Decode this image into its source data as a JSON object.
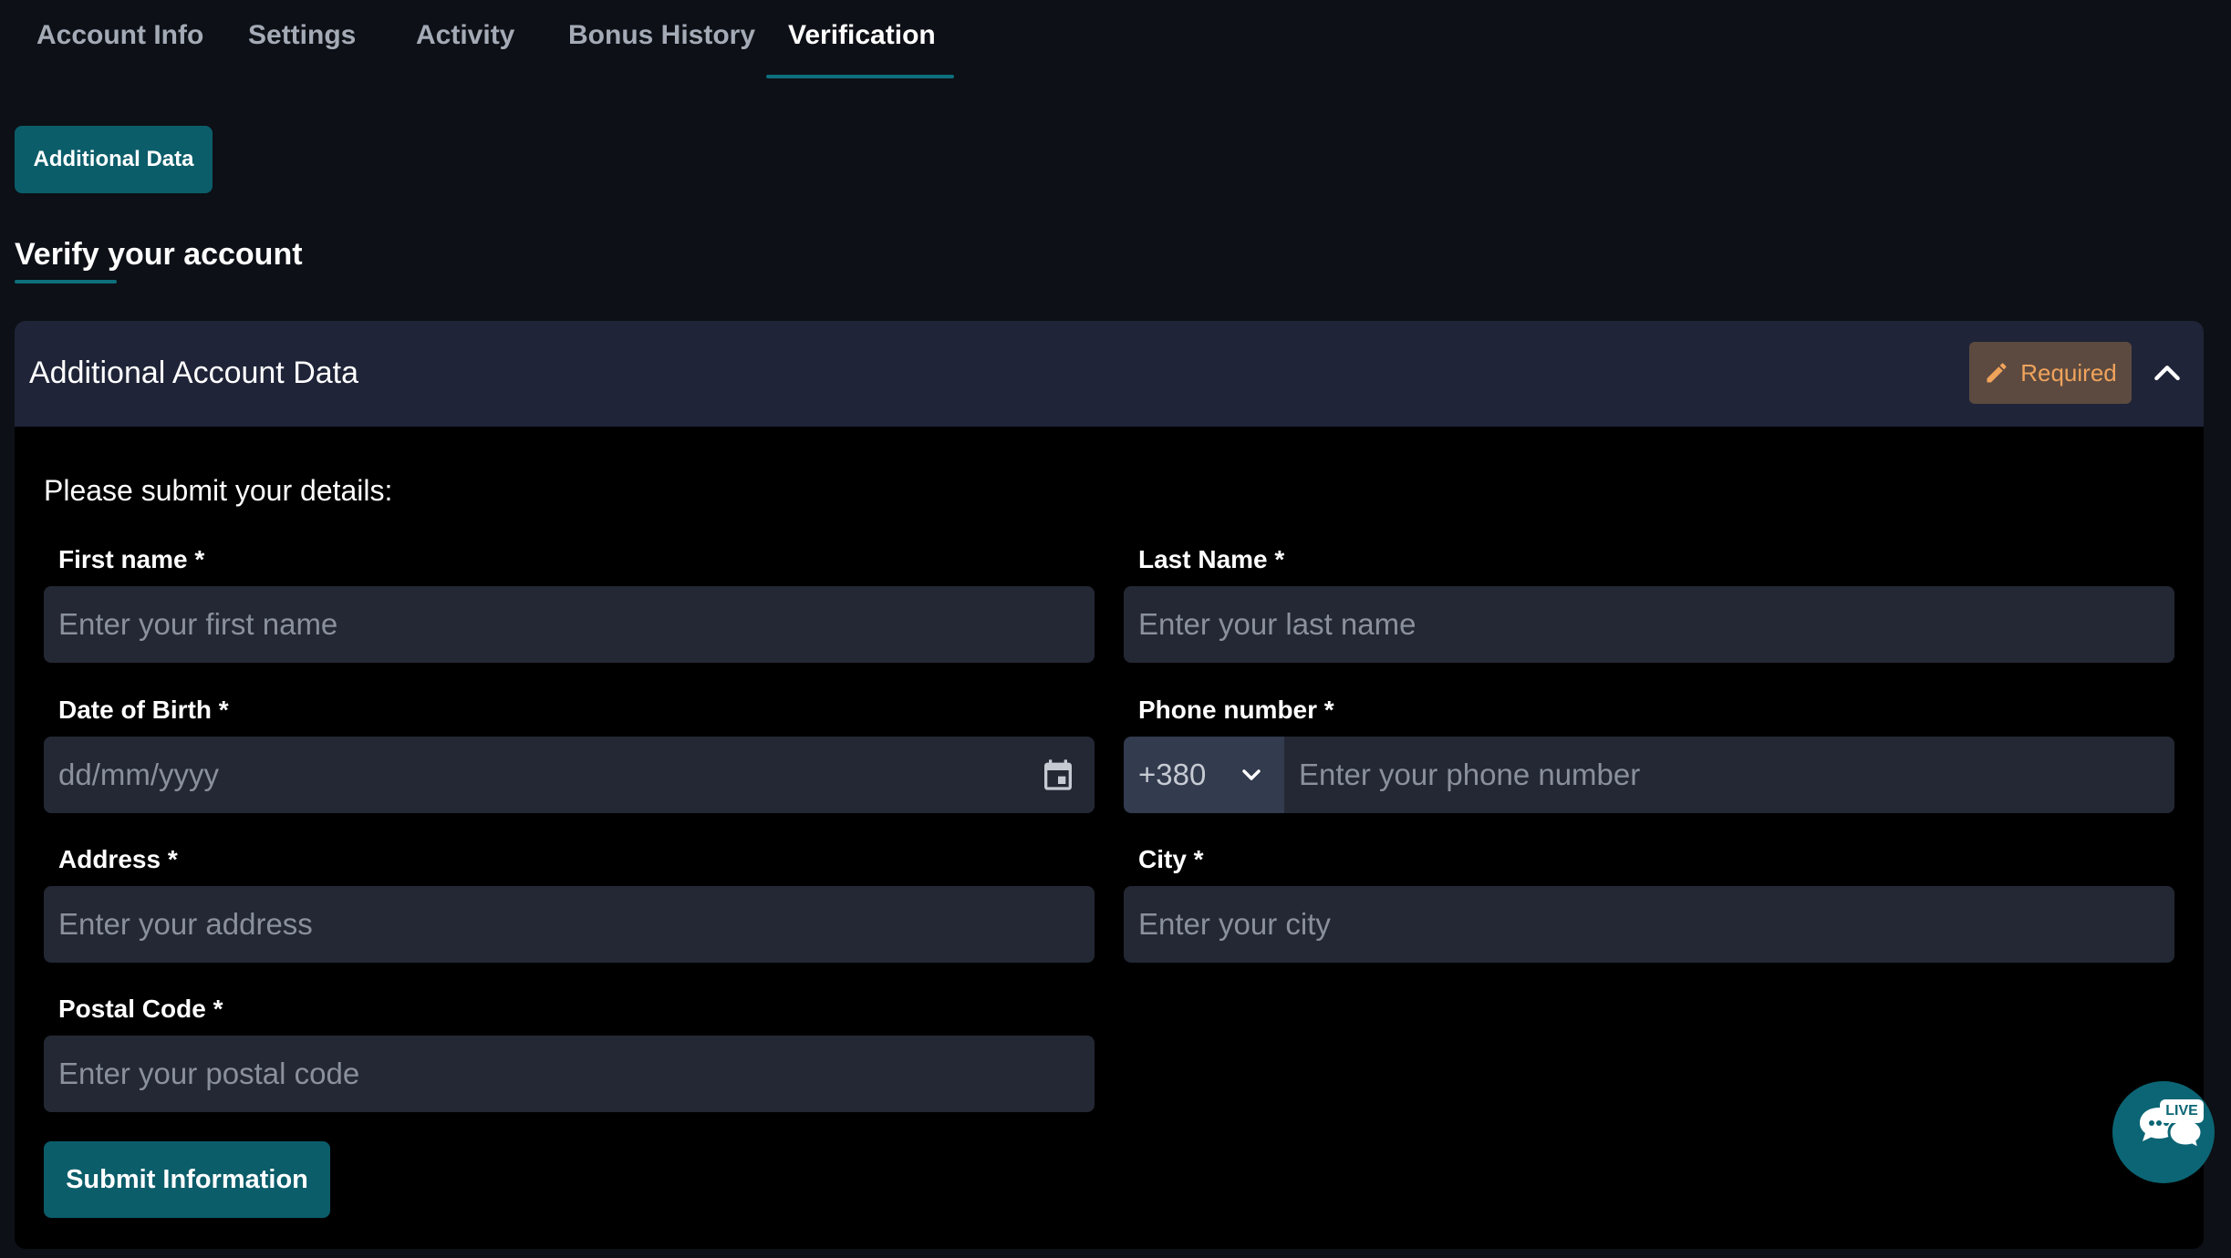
{
  "tabs": [
    {
      "label": "Account Info"
    },
    {
      "label": "Settings"
    },
    {
      "label": "Activity"
    },
    {
      "label": "Bonus History"
    },
    {
      "label": "Verification",
      "active": true
    }
  ],
  "additional_data_button": "Additional Data",
  "section_title": "Verify your account",
  "card": {
    "title": "Additional Account Data",
    "badge": "Required",
    "intro": "Please submit your details:"
  },
  "form": {
    "first_name": {
      "label": "First name *",
      "placeholder": "Enter your first name",
      "value": ""
    },
    "last_name": {
      "label": "Last Name *",
      "placeholder": "Enter your last name",
      "value": ""
    },
    "dob": {
      "label": "Date of Birth *",
      "placeholder": "dd/mm/yyyy",
      "value": ""
    },
    "phone": {
      "label": "Phone number *",
      "prefix": "+380",
      "placeholder": "Enter your phone number",
      "value": ""
    },
    "address": {
      "label": "Address *",
      "placeholder": "Enter your address",
      "value": ""
    },
    "city": {
      "label": "City *",
      "placeholder": "Enter your city",
      "value": ""
    },
    "postal": {
      "label": "Postal Code *",
      "placeholder": "Enter your postal code",
      "value": ""
    },
    "submit": "Submit Information"
  },
  "live_chat": {
    "badge": "LIVE"
  },
  "colors": {
    "page_bg": "#0d1016",
    "accent": "#0b5d6a",
    "card_header": "#1f2438",
    "input_bg": "#232834",
    "badge_bg": "#5c4a40",
    "badge_text": "#f0a35b"
  },
  "icons": {
    "badge": "pencil-icon",
    "collapse": "chevron-up-icon",
    "date": "calendar-icon",
    "phone_prefix": "chevron-down-icon",
    "chat": "chat-bubbles-icon"
  }
}
